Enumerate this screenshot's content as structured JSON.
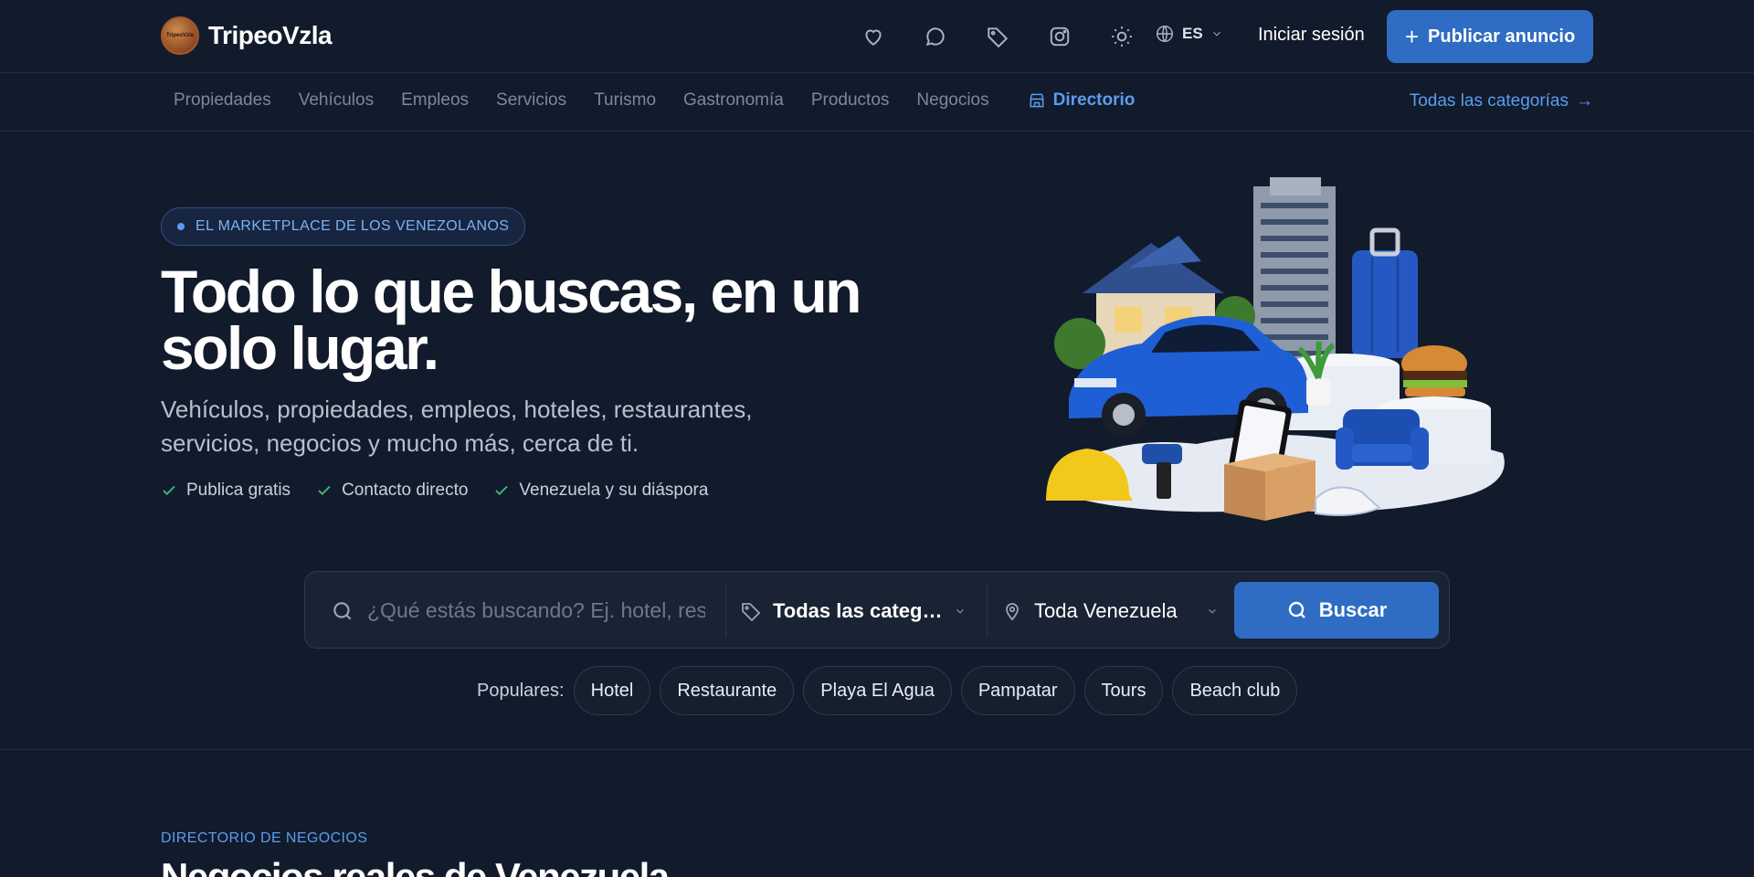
{
  "header": {
    "brand_name": "TripeoVzla",
    "logo_text": "TripeoVzla",
    "icons": [
      "heart-icon",
      "chat-icon",
      "tag-icon",
      "instagram-icon",
      "sun-icon"
    ],
    "language": "ES",
    "login_label": "Iniciar sesión",
    "publish_label": "Publicar anuncio",
    "accent_color": "#2f6cc4"
  },
  "category_nav": {
    "items": [
      "Propiedades",
      "Vehículos",
      "Empleos",
      "Servicios",
      "Turismo",
      "Gastronomía",
      "Productos",
      "Negocios"
    ],
    "active_item": "Directorio",
    "all_categories_label": "Todas las categorías"
  },
  "hero": {
    "badge": "EL MARKETPLACE DE LOS VENEZOLANOS",
    "title": "Todo lo que buscas, en un solo lugar.",
    "subtitle": "Vehículos, propiedades, empleos, hoteles, restaurantes, servicios, negocios y mucho más, cerca de ti.",
    "features": [
      "Publica gratis",
      "Contacto directo",
      "Venezuela y su diáspora"
    ]
  },
  "search": {
    "placeholder": "¿Qué estás buscando? Ej. hotel, restaurante, playa...",
    "category_value": "Todas las categorías",
    "location_value": "Toda Venezuela",
    "button_label": "Buscar"
  },
  "popular": {
    "label": "Populares:",
    "chips": [
      "Hotel",
      "Restaurante",
      "Playa El Agua",
      "Pampatar",
      "Tours",
      "Beach club"
    ]
  },
  "directory_section": {
    "kicker": "DIRECTORIO DE NEGOCIOS",
    "title": "Negocios reales de Venezuela"
  }
}
